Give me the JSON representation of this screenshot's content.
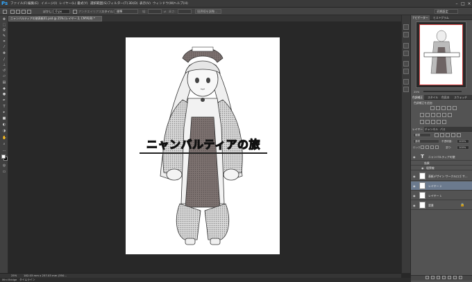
{
  "app": {
    "logo": "Ps"
  },
  "menu": [
    "ファイル(F)",
    "編集(E)",
    "イメージ(I)",
    "レイヤー(L)",
    "書式(Y)",
    "選択範囲(S)",
    "フィルター(T)",
    "3D(D)",
    "表示(V)",
    "ウィンドウ(W)",
    "ヘルプ(H)"
  ],
  "options": {
    "feather_label": "ぼかし:",
    "feather_value": "0 px",
    "antialias_label": "アンチエイリアス",
    "style_label": "スタイル:",
    "style_value": "標準",
    "width_label": "幅:",
    "height_label": "高さ:",
    "refine_button": "境界線を調整...",
    "workspace": "初期設定"
  },
  "document_tab": "ニャンバルティアの旅表紙01.psd @ 25% (レイヤー 2, CMYK/8) *",
  "artwork_title": "ニャンバルティアの旅",
  "status": {
    "zoom": "25%",
    "doc_size": "182.03 mm x 257.03 mm (350..."
  },
  "bottom_tabs": [
    "Mini Bridge",
    "タイムライン"
  ],
  "navigator": {
    "tabs": [
      "ナビゲーター",
      "ヒストグラム"
    ],
    "zoom": "25%"
  },
  "adjustments": {
    "tabs": [
      "色調補正",
      "スタイル",
      "色見本",
      "スウォッチ"
    ],
    "heading": "色調補正を追加"
  },
  "layers_panel": {
    "tabs": [
      "レイヤー",
      "チャンネル",
      "パス"
    ],
    "filter": "種類",
    "blend_mode": "通常",
    "opacity_label": "不透明度:",
    "opacity_value": "100%",
    "lock_label": "ロック:",
    "fill_label": "塗り:",
    "fill_value": "100%",
    "layers": [
      {
        "name": "ニャンバルティアの旅",
        "kind": "text",
        "selected": false
      },
      {
        "name": "効果",
        "kind": "effect",
        "selected": false
      },
      {
        "name": "境界線",
        "kind": "effect",
        "selected": false
      },
      {
        "name": "表紙デザイン サークルロゴ サ...",
        "kind": "image",
        "selected": false
      },
      {
        "name": "レイヤー 2",
        "kind": "image",
        "selected": true
      },
      {
        "name": "レイヤー 1",
        "kind": "image",
        "selected": false
      },
      {
        "name": "背景",
        "kind": "background",
        "selected": false
      }
    ]
  },
  "colors": {
    "accent_ps": "#31a8ff",
    "selected_layer": "#6b7a8e",
    "navigator_frame": "#d23a3a"
  }
}
